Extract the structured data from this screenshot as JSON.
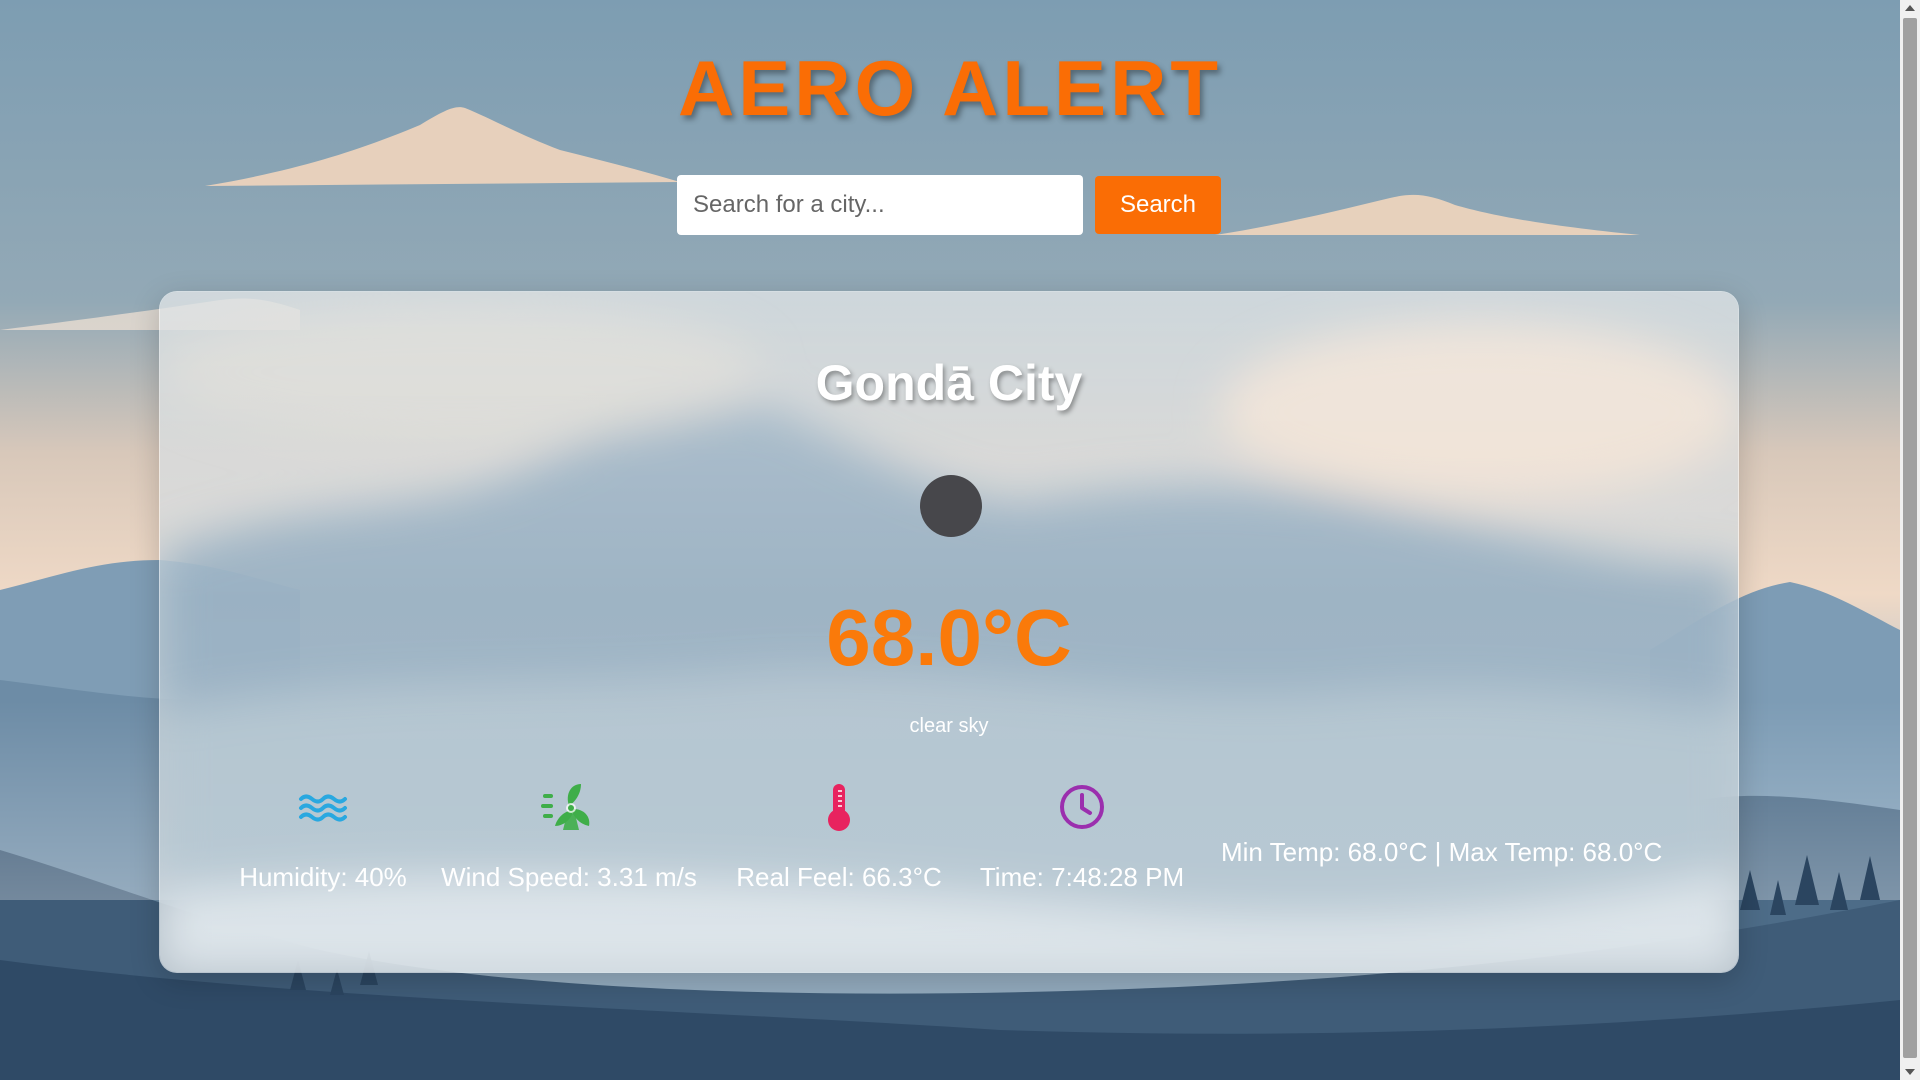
{
  "app": {
    "title": "AERO ALERT"
  },
  "search": {
    "placeholder": "Search for a city...",
    "value": "",
    "button_label": "Search"
  },
  "weather": {
    "city": "Gondā City",
    "icon": "weather-icon",
    "temperature": "68.0°C",
    "description": "clear sky",
    "stats": [
      {
        "icon": "humidity-waves-icon",
        "color": "#29a8e0",
        "label": "Humidity: 40%"
      },
      {
        "icon": "wind-fan-icon",
        "color": "#3fae49",
        "label": "Wind Speed: 3.31 m/s"
      },
      {
        "icon": "thermometer-icon",
        "color": "#e8235f",
        "label": "Real Feel: 66.3°C"
      },
      {
        "icon": "clock-icon",
        "color": "#9b2fae",
        "label": "Time: 7:48:28 PM"
      }
    ],
    "min_max": "Min Temp: 68.0°C | Max Temp: 68.0°C"
  },
  "colors": {
    "accent": "#fa6d05",
    "temperature": "#fa7a0a"
  }
}
